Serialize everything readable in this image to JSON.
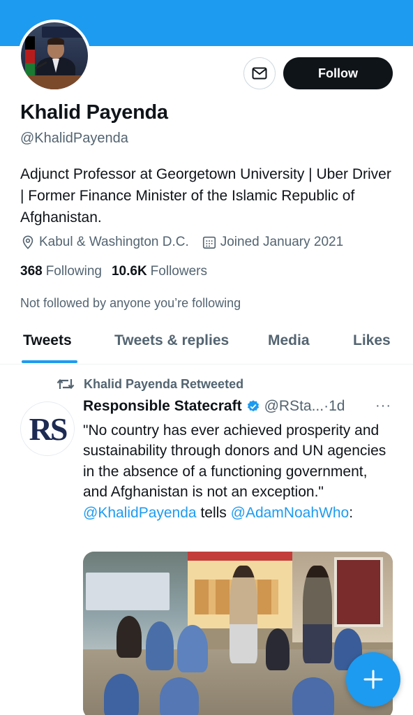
{
  "theme": {
    "accent": "#1d9bf0",
    "text": "#0f1419",
    "secondary": "#536471"
  },
  "profile": {
    "name": "Khalid Payenda",
    "handle": "@KhalidPayenda",
    "bio": "Adjunct Professor at Georgetown University | Uber Driver | Former Finance Minister of the Islamic Republic of Afghanistan.",
    "location": "Kabul & Washington D.C.",
    "joined": "Joined January 2021",
    "following_count": "368",
    "following_label": "Following",
    "followers_count": "10.6K",
    "followers_label": "Followers",
    "not_followed_note": "Not followed by anyone you’re following",
    "follow_label": "Follow"
  },
  "tabs": [
    {
      "label": "Tweets",
      "active": true
    },
    {
      "label": "Tweets & replies",
      "active": false
    },
    {
      "label": "Media",
      "active": false
    },
    {
      "label": "Likes",
      "active": false
    }
  ],
  "tweet": {
    "retweeted_by": "Khalid Payenda Retweeted",
    "author_avatar_text": "RS",
    "author_name": "Responsible Statecraft",
    "author_handle": "@RSta...",
    "separator": " · ",
    "time": "1d",
    "more": "···",
    "text_main": "\"No country has ever achieved prosperity and sustainability through donors and UN agencies in the absence of a functioning government, and Afghanistan is not an exception.\" ",
    "mention1": "@KhalidPayenda",
    "text_mid": " tells ",
    "mention2": "@AdamNoahWho",
    "text_end": ":"
  },
  "icons": {
    "mail": "mail-icon",
    "location": "location-pin-icon",
    "calendar": "calendar-icon",
    "retweet": "retweet-icon",
    "verified": "verified-badge-icon",
    "compose": "plus-icon"
  }
}
